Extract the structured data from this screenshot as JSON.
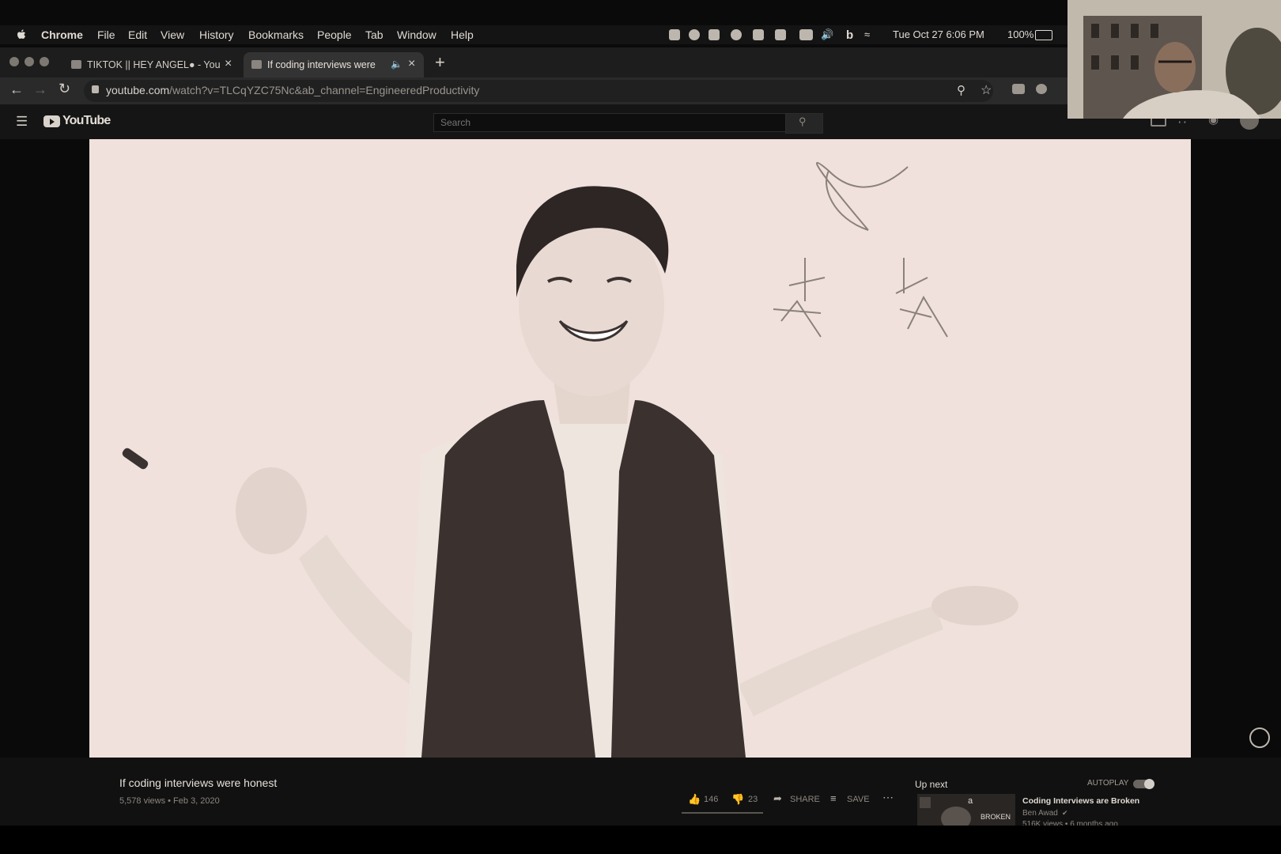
{
  "menubar": {
    "app": "Chrome",
    "items": [
      "File",
      "Edit",
      "View",
      "History",
      "Bookmarks",
      "People",
      "Tab",
      "Window",
      "Help"
    ],
    "clock": "Tue Oct 27  6:06 PM",
    "battery": "100%"
  },
  "tabs": [
    {
      "title": "TIKTOK || HEY ANGEL● - You"
    },
    {
      "title": "If coding interviews were h"
    }
  ],
  "address": {
    "host": "youtube.com",
    "path": "/watch?v=TLCqYZC75Nc&ab_channel=EngineeredProductivity"
  },
  "youtube": {
    "logo": "YouTube",
    "search_placeholder": "Search"
  },
  "video": {
    "title": "If coding interviews were honest",
    "meta": "5,578 views • Feb 3, 2020",
    "likes": "146",
    "dislikes": "23",
    "share_label": "SHARE",
    "save_label": "SAVE"
  },
  "upnext": {
    "label": "Up next",
    "autoplay_label": "AUTOPLAY",
    "item": {
      "title": "Coding Interviews are Broken",
      "channel": "Ben Awad",
      "meta": "516K views • 6 months ago",
      "thumb_text": "BROKEN"
    }
  },
  "colors": {
    "video_bg": "#f0e1dc",
    "chrome_dark": "#1d1d1d",
    "text_light": "#d8d2cc"
  }
}
